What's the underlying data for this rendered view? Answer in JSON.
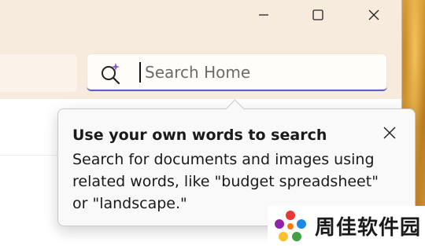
{
  "window": {
    "caption": {
      "minimize_icon": "minimize-icon",
      "maximize_icon": "maximize-icon",
      "close_icon": "close-icon"
    }
  },
  "search": {
    "placeholder": "Search Home",
    "value": "",
    "icon": "ai-search-icon",
    "accent_color": "#5b5fc7"
  },
  "tooltip": {
    "title": "Use your own words to search",
    "body": "Search for documents and images using related words, like \"budget spreadsheet\" or \"landscape.\"",
    "close_icon": "close-icon"
  },
  "watermark": {
    "text": "周佳软件园"
  }
}
